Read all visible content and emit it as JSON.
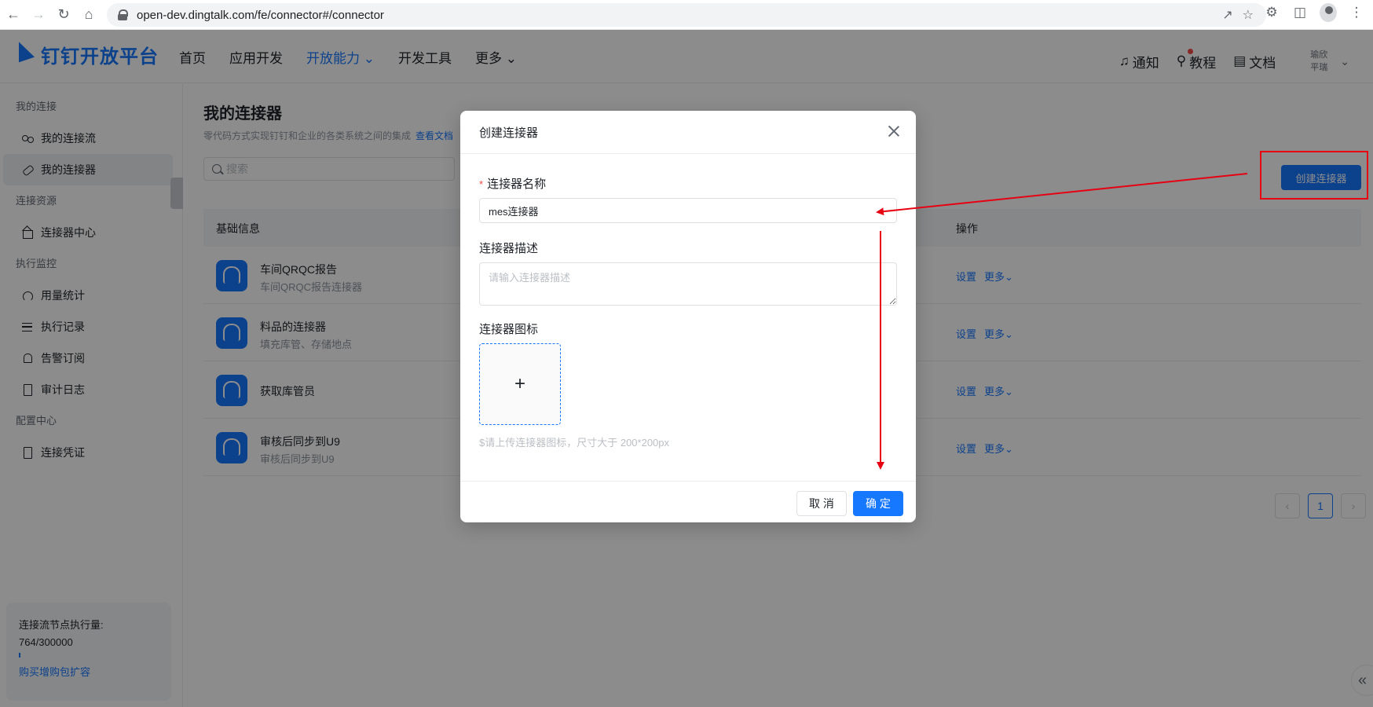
{
  "browser": {
    "url": "open-dev.dingtalk.com/fe/connector#/connector"
  },
  "header": {
    "logo_text": "钉钉开放平台",
    "nav": [
      "首页",
      "应用开发",
      "开放能力",
      "开发工具",
      "更多"
    ],
    "notice": "通知",
    "tutorial": "教程",
    "docs": "文档",
    "user_line1": "瑜欣",
    "user_line2": "平瑞"
  },
  "sidebar": {
    "groups": [
      {
        "title": "我的连接",
        "items": [
          "我的连接流",
          "我的连接器"
        ]
      },
      {
        "title": "连接资源",
        "items": [
          "连接器中心"
        ]
      },
      {
        "title": "执行监控",
        "items": [
          "用量统计",
          "执行记录",
          "告警订阅",
          "审计日志"
        ]
      },
      {
        "title": "配置中心",
        "items": [
          "连接凭证"
        ]
      }
    ],
    "usage_label": "连接流节点执行量:",
    "usage_value": "764/300000",
    "usage_link": "购买增购包扩容"
  },
  "page": {
    "title": "我的连接器",
    "subtitle": "零代码方式实现钉钉和企业的各类系统之间的集成",
    "doc_link": "查看文档",
    "search_placeholder": "搜索",
    "create_button": "创建连接器",
    "col_basic": "基础信息",
    "col_ops": "操作",
    "rows": [
      {
        "name": "车间QRQC报告",
        "desc": "车间QRQC报告连接器"
      },
      {
        "name": "料品的连接器",
        "desc": "填充库管、存储地点"
      },
      {
        "name": "获取库管员",
        "desc": ""
      },
      {
        "name": "审核后同步到U9",
        "desc": "审核后同步到U9"
      }
    ],
    "op_settings": "设置",
    "op_more": "更多",
    "current_page": "1"
  },
  "modal": {
    "title": "创建连接器",
    "name_label": "连接器名称",
    "name_value": "mes连接器",
    "desc_label": "连接器描述",
    "desc_placeholder": "请输入连接器描述",
    "icon_label": "连接器图标",
    "hint": "$请上传连接器图标，尺寸大于 200*200px",
    "cancel": "取 消",
    "ok": "确 定"
  },
  "colors": {
    "accent": "#1677ff",
    "annotation": "#e60012"
  }
}
